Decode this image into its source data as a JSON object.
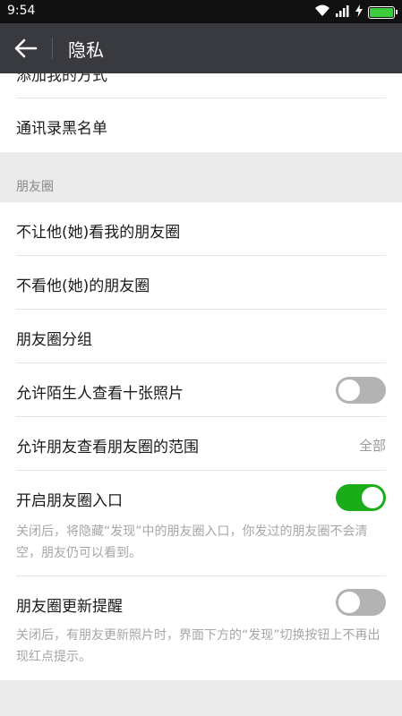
{
  "status_bar": {
    "time": "9:54"
  },
  "nav": {
    "title": "隐私"
  },
  "partial_row": {
    "label": "添加我的方式"
  },
  "blacklist": {
    "label": "通讯录黑名单"
  },
  "moments": {
    "section_title": "朋友圈",
    "block_them": "不让他(她)看我的朋友圈",
    "hide_their": "不看他(她)的朋友圈",
    "groups": "朋友圈分组",
    "stranger_ten_photos": {
      "label": "允许陌生人查看十张照片",
      "enabled": false
    },
    "friends_range": {
      "label": "允许朋友查看朋友圈的范围",
      "value": "全部"
    },
    "enable_entry": {
      "label": "开启朋友圈入口",
      "enabled": true,
      "description": "关闭后，将隐藏“发现”中的朋友圈入口，你发过的朋友圈不会清空，朋友仍可以看到。"
    },
    "update_reminder": {
      "label": "朋友圈更新提醒",
      "enabled": false,
      "description": "关闭后，有朋友更新照片时，界面下方的“发现”切换按钮上不再出现红点提示。"
    }
  },
  "colors": {
    "toggle_on": "#1aad19",
    "toggle_off": "#b3b3b3",
    "nav_bg": "#393a3f"
  }
}
